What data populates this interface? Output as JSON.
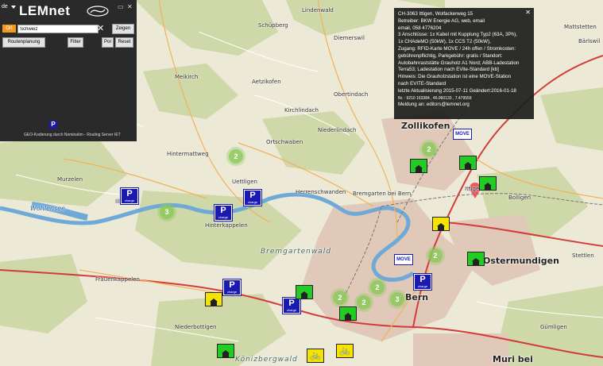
{
  "panel": {
    "lang": "de",
    "logo": "LEMnet",
    "win_min": "▭",
    "win_close": "✕",
    "ort_label": "Ort",
    "search_value": "Schweiz",
    "clear": "✕",
    "zeigen": "Zeigen",
    "routenplanung": "Routenplanung",
    "filter": "Filter",
    "poi": "PoI",
    "reset": "Reset",
    "credit": "GEO-Kodierung durch Nominatim - Routing Server IET"
  },
  "info": {
    "lines": [
      "CH-3063 Ittigen, Wolfackerweg 15",
      "Betreiber: BKW Energie AG, web, email",
      "email, 058 4776204",
      "3 Anschlüsse: 1x Kabel mit Kupplung Typ2 (63A, 3Ph),",
      "1x CHAdeMO (50kW), 1x CCS T2 (50kW),",
      "Zugang: RFID-Karte MOVE / 24h offen / Stromkosten:",
      "gebührenpflichtig, Parkgebühr: gratis / Standort:",
      "Autobahnraststätte Grauholz A1 Nord; ABB-Ladestation",
      "Terra53; Ladestation nach EVite-Standard [kb]",
      "Hinweis: Die Grauholzstation ist eine MOVE-Station",
      "nach EVITE-Standard",
      "letzte Aktualisierung 2015-07-11 Geändert:2016-01-18",
      "Nr. : 9210  163384 , 46.960133 , 7.479559",
      "Meldung an: editors@lemnet.org"
    ],
    "close": "✕"
  },
  "map": {
    "labels": [
      {
        "t": "Lindenwald",
        "k": "lbl"
      },
      {
        "t": "Schüpberg",
        "k": "lbl"
      },
      {
        "t": "Diemerswil",
        "k": "lbl"
      },
      {
        "t": "Meikirch",
        "k": "lbl"
      },
      {
        "t": "Aetzikofen",
        "k": "lbl"
      },
      {
        "t": "Obertindach",
        "k": "lbl"
      },
      {
        "t": "Kirchlindach",
        "k": "lbl"
      },
      {
        "t": "Niederlindach",
        "k": "lbl"
      },
      {
        "t": "Zollikofen",
        "k": "big"
      },
      {
        "t": "Hintermattweg",
        "k": "lbl"
      },
      {
        "t": "Ortschwaben",
        "k": "lbl"
      },
      {
        "t": "Uettligen",
        "k": "lbl"
      },
      {
        "t": "Illiswil",
        "k": "lbl"
      },
      {
        "t": "Murzelen",
        "k": "lbl"
      },
      {
        "t": "Herrenschwanden",
        "k": "lbl"
      },
      {
        "t": "Bremgarten bei Bern",
        "k": "lbl"
      },
      {
        "t": "Wohlensee",
        "k": "italic"
      },
      {
        "t": "Hinterkappelen",
        "k": "lbl"
      },
      {
        "t": "Bremgartenwald",
        "k": "region"
      },
      {
        "t": "Frauenkappelen",
        "k": "lbl"
      },
      {
        "t": "Bern",
        "k": "big"
      },
      {
        "t": "Ostermundigen",
        "k": "big"
      },
      {
        "t": "Muri bei",
        "k": "big"
      },
      {
        "t": "Bolligen",
        "k": "lbl"
      },
      {
        "t": "Ittigen",
        "k": "lbl"
      },
      {
        "t": "Könizbergwald",
        "k": "region"
      },
      {
        "t": "Niederbottigen",
        "k": "lbl"
      },
      {
        "t": "Stettlen",
        "k": "lbl"
      },
      {
        "t": "Gümligen",
        "k": "lbl"
      },
      {
        "t": "Mattstetten",
        "k": "lbl"
      },
      {
        "t": "Bärlswil",
        "k": "lbl"
      },
      {
        "t": "Schüpberg",
        "k": "lbl"
      }
    ],
    "clusters": [
      "2",
      "3",
      "2",
      "2",
      "2",
      "2",
      "3"
    ],
    "move": "MOVE",
    "p_label": "P",
    "p_sub": "charge"
  },
  "colors": {
    "panel_bg": "#2a2a2a",
    "ort": "#f39a1d",
    "park_marker": "#1a1ab0",
    "house_green": "#22cc22",
    "house_yellow": "#f4e400",
    "cluster": "#8cc85a",
    "water": "#6fa9d8"
  }
}
